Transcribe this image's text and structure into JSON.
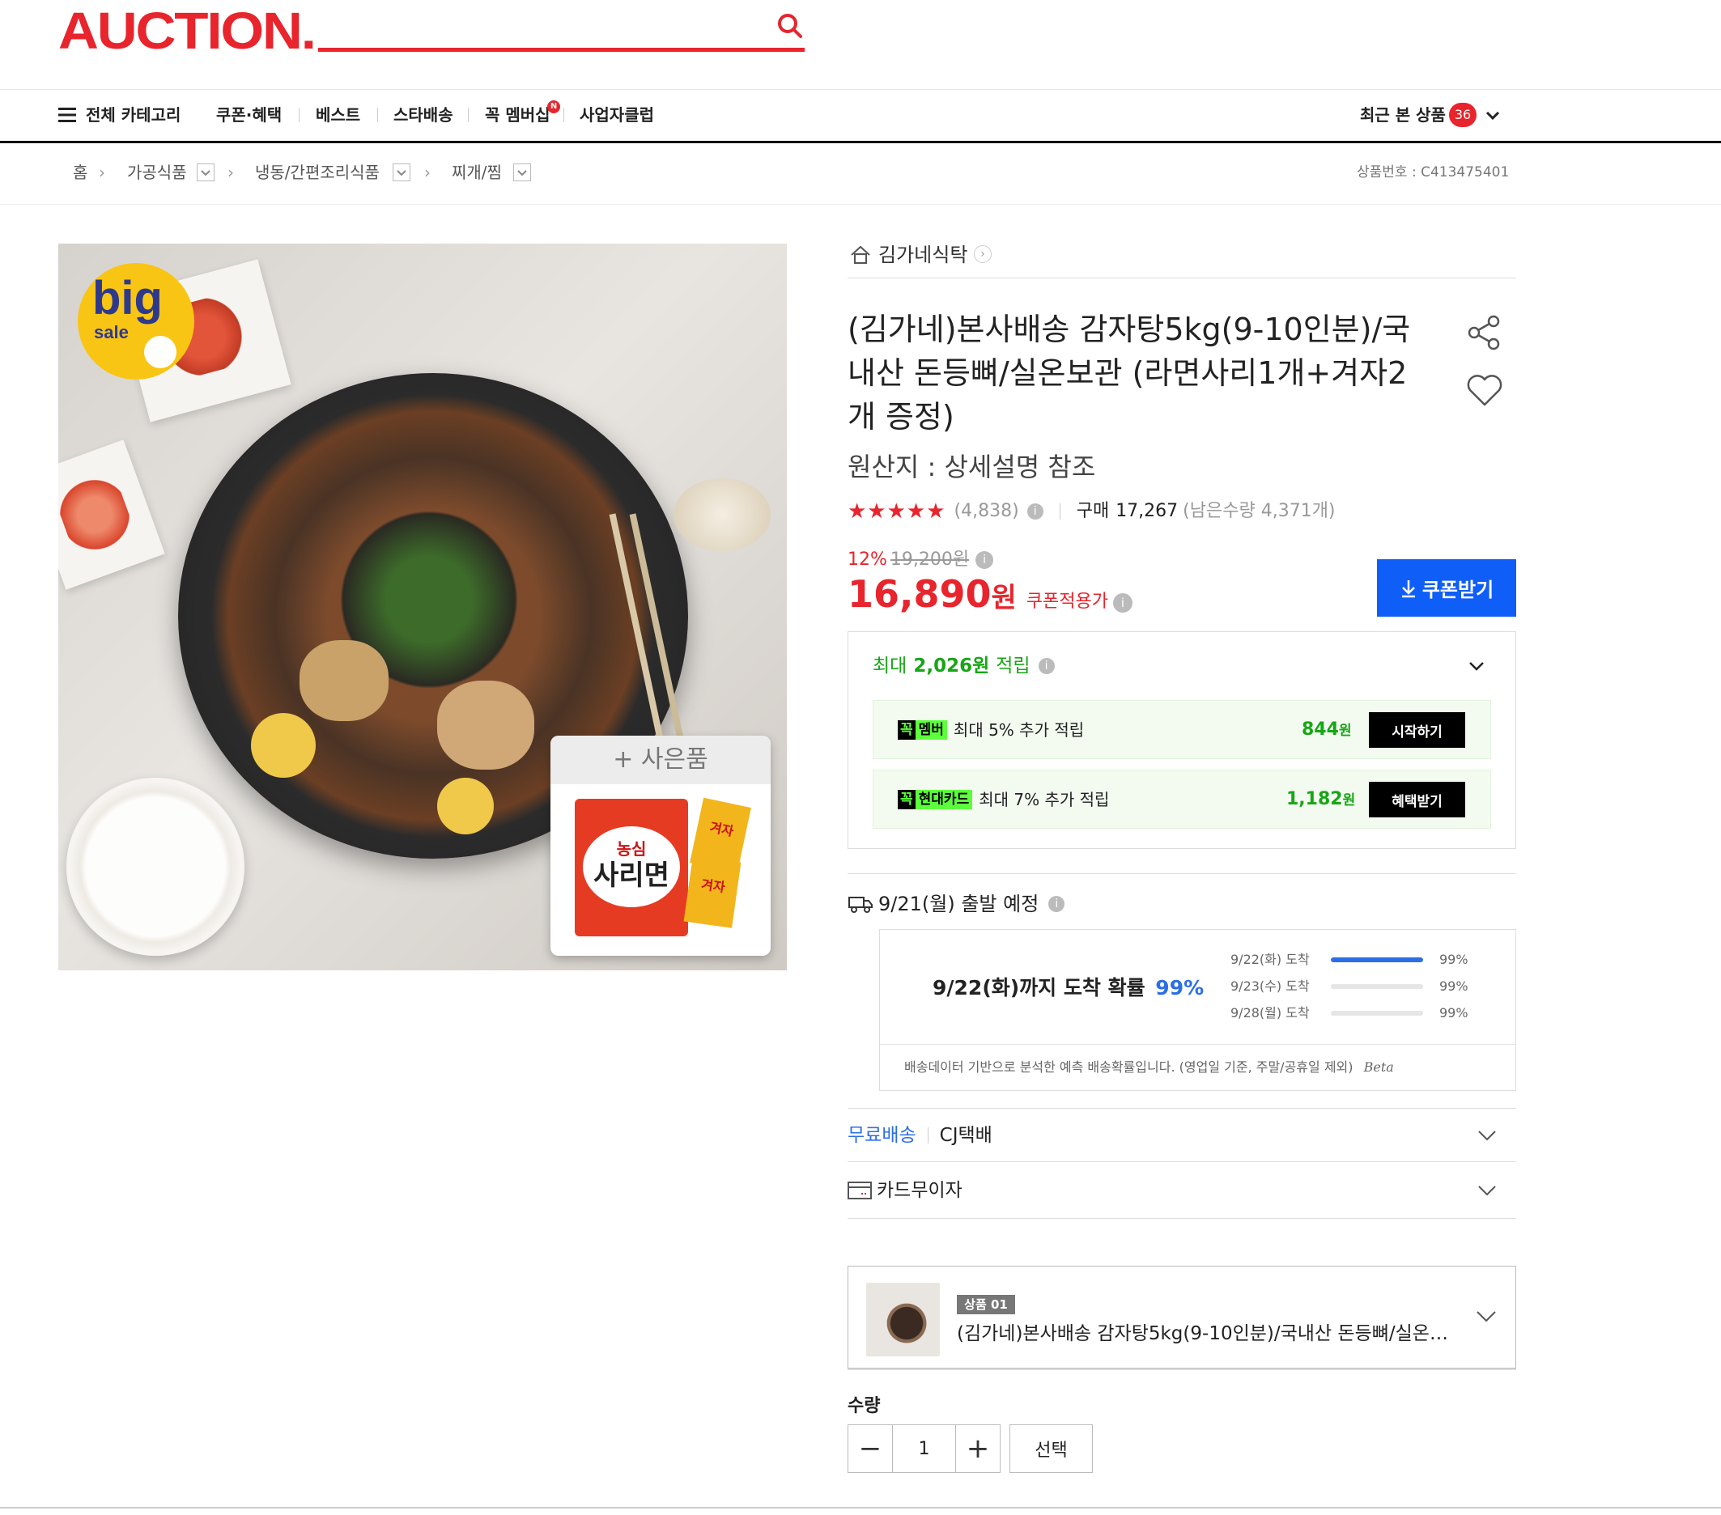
{
  "header": {
    "logo": "AUCTION.",
    "nav": [
      {
        "label": "전체 카테고리"
      },
      {
        "label": "쿠폰·혜택"
      },
      {
        "label": "베스트"
      },
      {
        "label": "스타배송"
      },
      {
        "label": "꼭 멤버십",
        "badge": "N"
      },
      {
        "label": "사업자클럽"
      }
    ],
    "recent_label": "최근 본 상품",
    "recent_count": "36"
  },
  "breadcrumb": {
    "items": [
      "홈",
      "가공식품",
      "냉동/간편조리식품",
      "찌개/찜"
    ],
    "product_no_label": "상품번호 : C413475401"
  },
  "image": {
    "badge_big": "big",
    "badge_sale": "sale",
    "gift_label": "+ 사은품",
    "gift_brand": "농심",
    "gift_name": "사리면",
    "gift_sub": "겨자"
  },
  "product": {
    "store": "김가네식탁",
    "title": "(김가네)본사배송 감자탕5kg(9-10인분)/국내산 돈등뼈/실온보관 (라면사리1개+겨자2개 증정)",
    "origin": "원산지 : 상세설명 참조",
    "stars": "★★★★★",
    "review_count": "(4,838)",
    "purchase_label": "구매",
    "purchase_count": "17,267",
    "remaining": "(남은수량 4,371개)",
    "discount_rate": "12%",
    "original_price": "19,200원",
    "price": "16,890",
    "price_unit": "원",
    "coupon_price_label": "쿠폰적용가",
    "coupon_button": "쿠폰받기"
  },
  "points": {
    "max_prefix": "최대",
    "max_amount": "2,026원",
    "max_suffix": "적립",
    "rows": [
      {
        "tag1": "꼭",
        "tag2": "멤버",
        "text": "최대 5% 추가 적립",
        "amount": "844",
        "unit": "원",
        "button": "시작하기"
      },
      {
        "tag1": "꼭",
        "tag2": "현대카드",
        "text": "최대 7% 추가 적립",
        "amount": "1,182",
        "unit": "원",
        "button": "혜택받기"
      }
    ]
  },
  "shipping": {
    "departure": "9/21(월) 출발 예정",
    "summary_prefix": "9/22(화)까지 도착 확률",
    "summary_pct": "99%",
    "bars": [
      {
        "label": "9/22(화) 도착",
        "pct_text": "99%",
        "fill": 1.0,
        "active": true
      },
      {
        "label": "9/23(수) 도착",
        "pct_text": "99%",
        "fill": 0,
        "active": false
      },
      {
        "label": "9/28(월) 도착",
        "pct_text": "99%",
        "fill": 0,
        "active": false
      }
    ],
    "note": "배송데이터 기반으로 분석한 예측 배송확률입니다. (영업일 기준, 주말/공휴일 제외)",
    "beta": "Beta",
    "free_label": "무료배송",
    "carrier": "CJ택배",
    "card_label": "카드무이자"
  },
  "option": {
    "tag": "상품 01",
    "name": "(김가네)본사배송 감자탕5kg(9-10인분)/국내산 돈등뼈/실온보..."
  },
  "quantity": {
    "label": "수량",
    "value": "1",
    "minus": "−",
    "plus": "+",
    "select": "선택"
  },
  "colors": {
    "brand": "#e8242c",
    "accent_blue": "#0f5ef7",
    "points_green": "#17a615"
  }
}
